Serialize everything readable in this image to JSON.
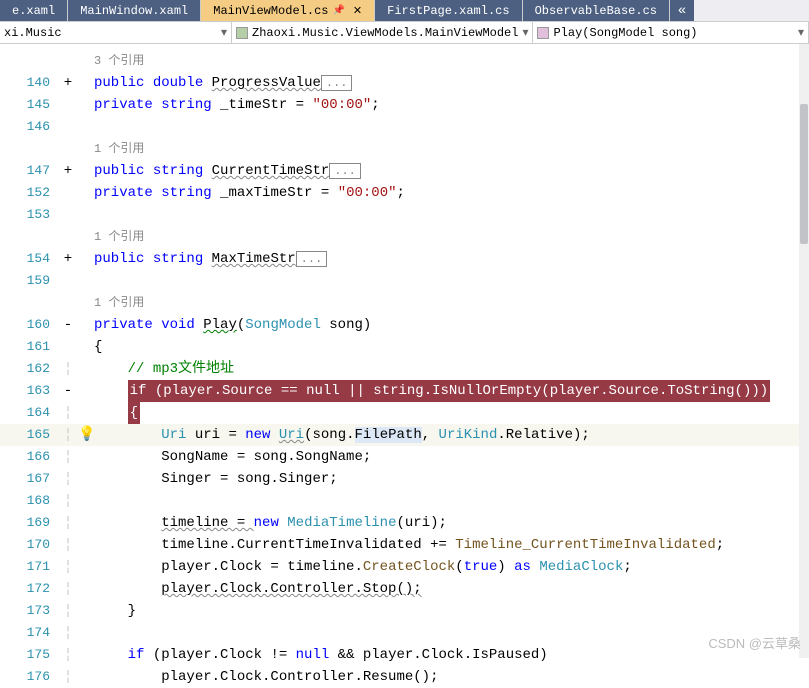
{
  "tabs": [
    {
      "label": "e.xaml",
      "active": false
    },
    {
      "label": "MainWindow.xaml",
      "active": false
    },
    {
      "label": "MainViewModel.cs",
      "active": true,
      "pinned": true,
      "closable": true
    },
    {
      "label": "FirstPage.xaml.cs",
      "active": false
    },
    {
      "label": "ObservableBase.cs",
      "active": false
    }
  ],
  "nav": {
    "project": "xi.Music",
    "class": "Zhaoxi.Music.ViewModels.MainViewModel",
    "member": "Play(SongModel song)"
  },
  "refs": {
    "r3": "3 个引用",
    "r1": "1 个引用"
  },
  "code": {
    "l140": {
      "kw1": "public",
      "kw2": "double",
      "id": "ProgressValue",
      "box": "..."
    },
    "l145": {
      "kw1": "private",
      "kw2": "string",
      "id": "_timeStr",
      "eq": " = ",
      "str": "\"00:00\"",
      "semi": ";"
    },
    "l147": {
      "kw1": "public",
      "kw2": "string",
      "id": "CurrentTimeStr",
      "box": "..."
    },
    "l152": {
      "kw1": "private",
      "kw2": "string",
      "id": "_maxTimeStr",
      "eq": " = ",
      "str": "\"00:00\"",
      "semi": ";"
    },
    "l154": {
      "kw1": "public",
      "kw2": "string",
      "id": "MaxTimeStr",
      "box": "..."
    },
    "l160": {
      "kw1": "private",
      "kw2": "void",
      "id": "Play",
      "args": "(",
      "ty": "SongModel",
      "args2": " song)"
    },
    "l161": "{",
    "l162": "// mp3文件地址",
    "l163": {
      "kw": "if",
      "txt": " (player.Source == ",
      "kw2": "null",
      "txt2": " || ",
      "kw3": "string",
      "txt3": ".IsNullOrEmpty(player.Source.ToString()))"
    },
    "l164": "{",
    "l165": {
      "ty1": "Uri",
      "id": " uri = ",
      "kw": "new",
      "sp": " ",
      "ty2": "Uri",
      "p1": "(song.",
      "fp": "FilePath",
      "p2": ", ",
      "ty3": "UriKind",
      "p3": ".Relative);"
    },
    "l166": "SongName = song.SongName;",
    "l167": "Singer = song.Singer;",
    "l169": {
      "id": "timeline = ",
      "kw": "new",
      "sp": " ",
      "ty": "MediaTimeline",
      "p": "(uri);"
    },
    "l170": {
      "t1": "timeline.CurrentTimeInvalidated += ",
      "m": "Timeline_CurrentTimeInvalidated",
      "t2": ";"
    },
    "l171": {
      "t1": "player.Clock = timeline.",
      "m": "CreateClock",
      "p1": "(",
      "kw1": "true",
      "p2": ") ",
      "kw2": "as",
      "sp": " ",
      "ty": "MediaClock",
      "t2": ";"
    },
    "l172": "player.Clock.Controller.Stop();",
    "l173": "}",
    "l175": {
      "kw": "if",
      "t1": " (player.Clock != ",
      "kw2": "null",
      "t2": " && player.Clock.IsPaused)"
    },
    "l176": "player.Clock.Controller.Resume();"
  },
  "lineNums": [
    "140",
    "145",
    "146",
    "",
    "147",
    "152",
    "153",
    "",
    "154",
    "159",
    "",
    "160",
    "161",
    "162",
    "163",
    "164",
    "165",
    "166",
    "167",
    "168",
    "169",
    "170",
    "171",
    "172",
    "173",
    "174",
    "175",
    "176"
  ],
  "fold": {
    "plus": "+",
    "minus": "-"
  },
  "watermark": "CSDN @云草桑"
}
